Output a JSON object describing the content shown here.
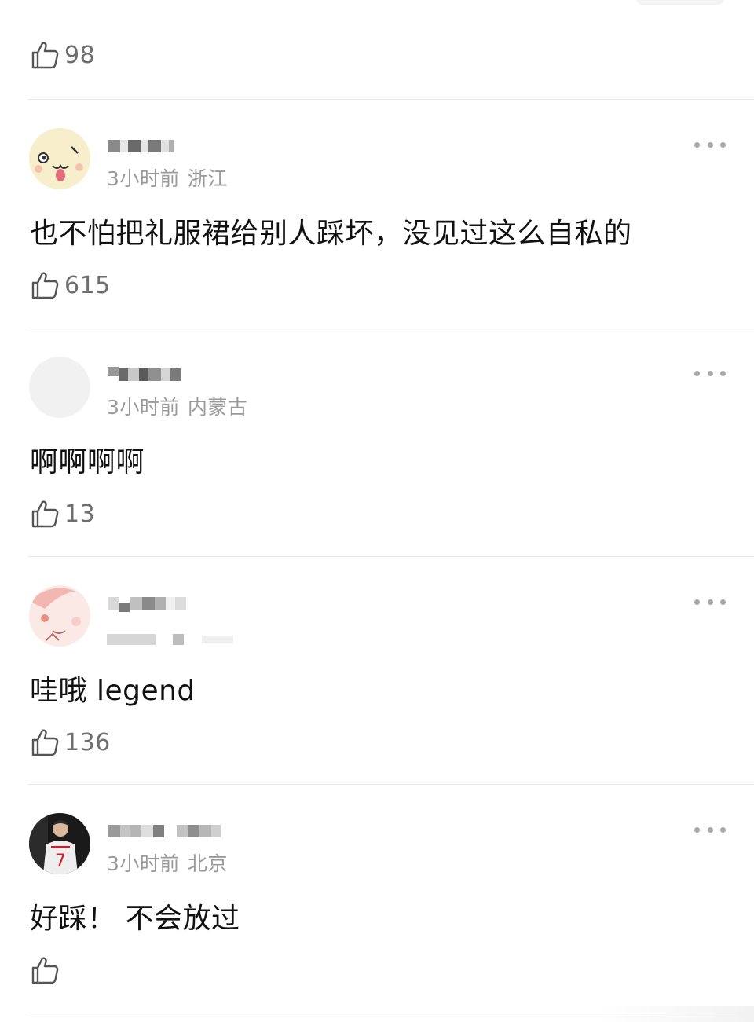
{
  "top": {
    "like_count": "98"
  },
  "comments": [
    {
      "time": "3小时前",
      "location": "浙江",
      "text": "也不怕把礼服裙给别人踩坏，没见过这么自私的",
      "like_count": "615",
      "avatar_icon": "cartoon-face-icon"
    },
    {
      "time": "3小时前",
      "location": "内蒙古",
      "text": "啊啊啊啊",
      "like_count": "13",
      "avatar_icon": "blank-avatar-icon"
    },
    {
      "time": "",
      "location": "",
      "text": "哇哦 legend",
      "like_count": "136",
      "avatar_icon": "pink-cartoon-avatar-icon"
    },
    {
      "time": "3小时前",
      "location": "北京",
      "text": "好踩！ 不会放过",
      "like_count": "",
      "avatar_icon": "football-player-avatar-icon"
    }
  ],
  "colors": {
    "meta_text": "#9a9a9a",
    "like_count": "#6e6e6e",
    "divider": "#e6e6e6",
    "more_dots": "#a8a8a8"
  }
}
